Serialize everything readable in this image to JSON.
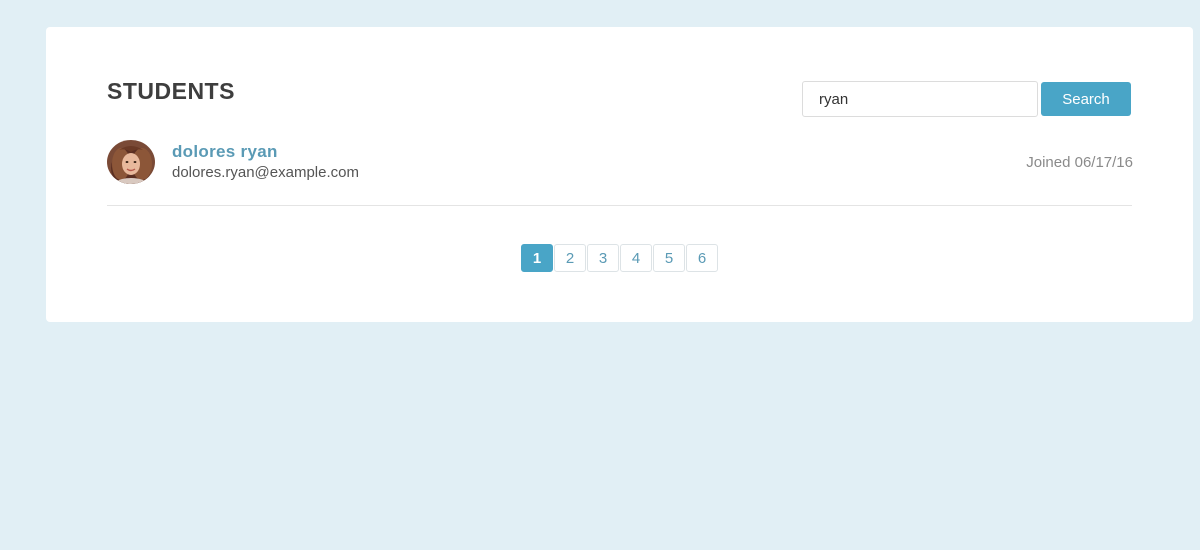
{
  "header": {
    "title": "STUDENTS"
  },
  "search": {
    "value": "ryan",
    "button_label": "Search"
  },
  "students": [
    {
      "name": "dolores ryan",
      "email": "dolores.ryan@example.com",
      "joined": "Joined 06/17/16"
    }
  ],
  "pagination": {
    "pages": [
      "1",
      "2",
      "3",
      "4",
      "5",
      "6"
    ],
    "active_page": "1"
  },
  "colors": {
    "page_background": "#e1eff5",
    "accent": "#49a5c7",
    "link": "#5a9ab5"
  }
}
